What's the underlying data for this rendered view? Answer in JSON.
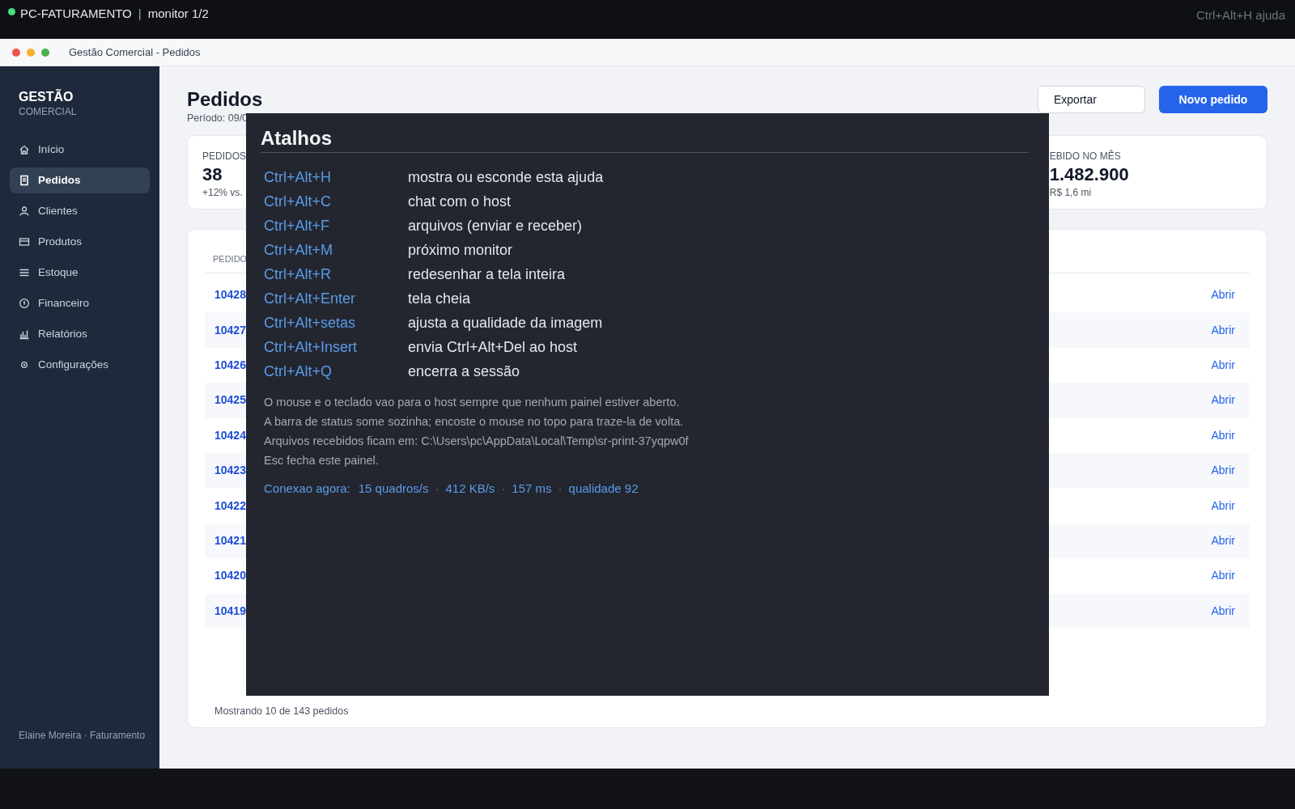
{
  "remote_bar": {
    "title_parts": [
      "PC-FATURAMENTO",
      "|",
      "monitor 1/2"
    ],
    "help_hint": "Ctrl+Alt+H ajuda"
  },
  "window": {
    "title": "Gestão Comercial - Pedidos"
  },
  "sidebar": {
    "brand": "GESTÃO",
    "brand_sub": "COMERCIAL",
    "items": [
      {
        "label": "Início",
        "selected": false
      },
      {
        "label": "Pedidos",
        "selected": true
      },
      {
        "label": "Clientes",
        "selected": false
      },
      {
        "label": "Produtos",
        "selected": false
      },
      {
        "label": "Estoque",
        "selected": false
      },
      {
        "label": "Financeiro",
        "selected": false
      },
      {
        "label": "Relatórios",
        "selected": false
      },
      {
        "label": "Configurações",
        "selected": false
      }
    ],
    "user": "Elaine Moreira · Faturamento"
  },
  "page": {
    "title": "Pedidos",
    "subtitle": "Período: 09/0",
    "actions": [
      {
        "label": "Exportar",
        "kind": "secondary"
      },
      {
        "label": "Novo pedido",
        "kind": "primary"
      }
    ]
  },
  "stats": [
    {
      "label": "PEDIDOS",
      "value": "38",
      "note": "+12% vs."
    },
    {
      "label": "EBIDO NO MÊS",
      "value": "1.482.900",
      "note": "R$ 1,6 mi"
    }
  ],
  "table": {
    "columns": [
      "PEDIDO"
    ],
    "rows": [
      {
        "order": "10428",
        "action": "Abrir"
      },
      {
        "order": "10427",
        "action": "Abrir"
      },
      {
        "order": "10426",
        "action": "Abrir"
      },
      {
        "order": "10425",
        "action": "Abrir"
      },
      {
        "order": "10424",
        "action": "Abrir"
      },
      {
        "order": "10423",
        "action": "Abrir"
      },
      {
        "order": "10422",
        "action": "Abrir"
      },
      {
        "order": "10421",
        "action": "Abrir"
      },
      {
        "order": "10420",
        "action": "Abrir"
      },
      {
        "order": "10419",
        "action": "Abrir"
      }
    ],
    "footer": "Mostrando 10 de 143 pedidos"
  },
  "help_panel": {
    "title": "Atalhos",
    "shortcuts": [
      {
        "keys": "Ctrl+Alt+H",
        "description": "mostra ou esconde esta ajuda"
      },
      {
        "keys": "Ctrl+Alt+C",
        "description": "chat com o host"
      },
      {
        "keys": "Ctrl+Alt+F",
        "description": "arquivos (enviar e receber)"
      },
      {
        "keys": "Ctrl+Alt+M",
        "description": "próximo monitor"
      },
      {
        "keys": "Ctrl+Alt+R",
        "description": "redesenhar a tela inteira"
      },
      {
        "keys": "Ctrl+Alt+Enter",
        "description": "tela cheia"
      },
      {
        "keys": "Ctrl+Alt+setas",
        "description": "ajusta a qualidade da imagem"
      },
      {
        "keys": "Ctrl+Alt+Insert",
        "description": "envia Ctrl+Alt+Del ao host"
      },
      {
        "keys": "Ctrl+Alt+Q",
        "description": "encerra a sessão"
      }
    ],
    "notes": [
      "O mouse e o teclado vao para o host sempre que nenhum painel estiver aberto.",
      "A barra de status some sozinha; encoste o mouse no topo para traze-la de volta.",
      "Arquivos recebidos ficam em: C:\\Users\\pc\\AppData\\Local\\Temp\\sr-print-37yqpw0f",
      "Esc fecha este painel."
    ],
    "connection": [
      "Conexao agora:",
      "15 quadros/s",
      "·",
      "412 KB/s",
      "·",
      "157 ms",
      "·",
      "qualidade 92"
    ]
  }
}
